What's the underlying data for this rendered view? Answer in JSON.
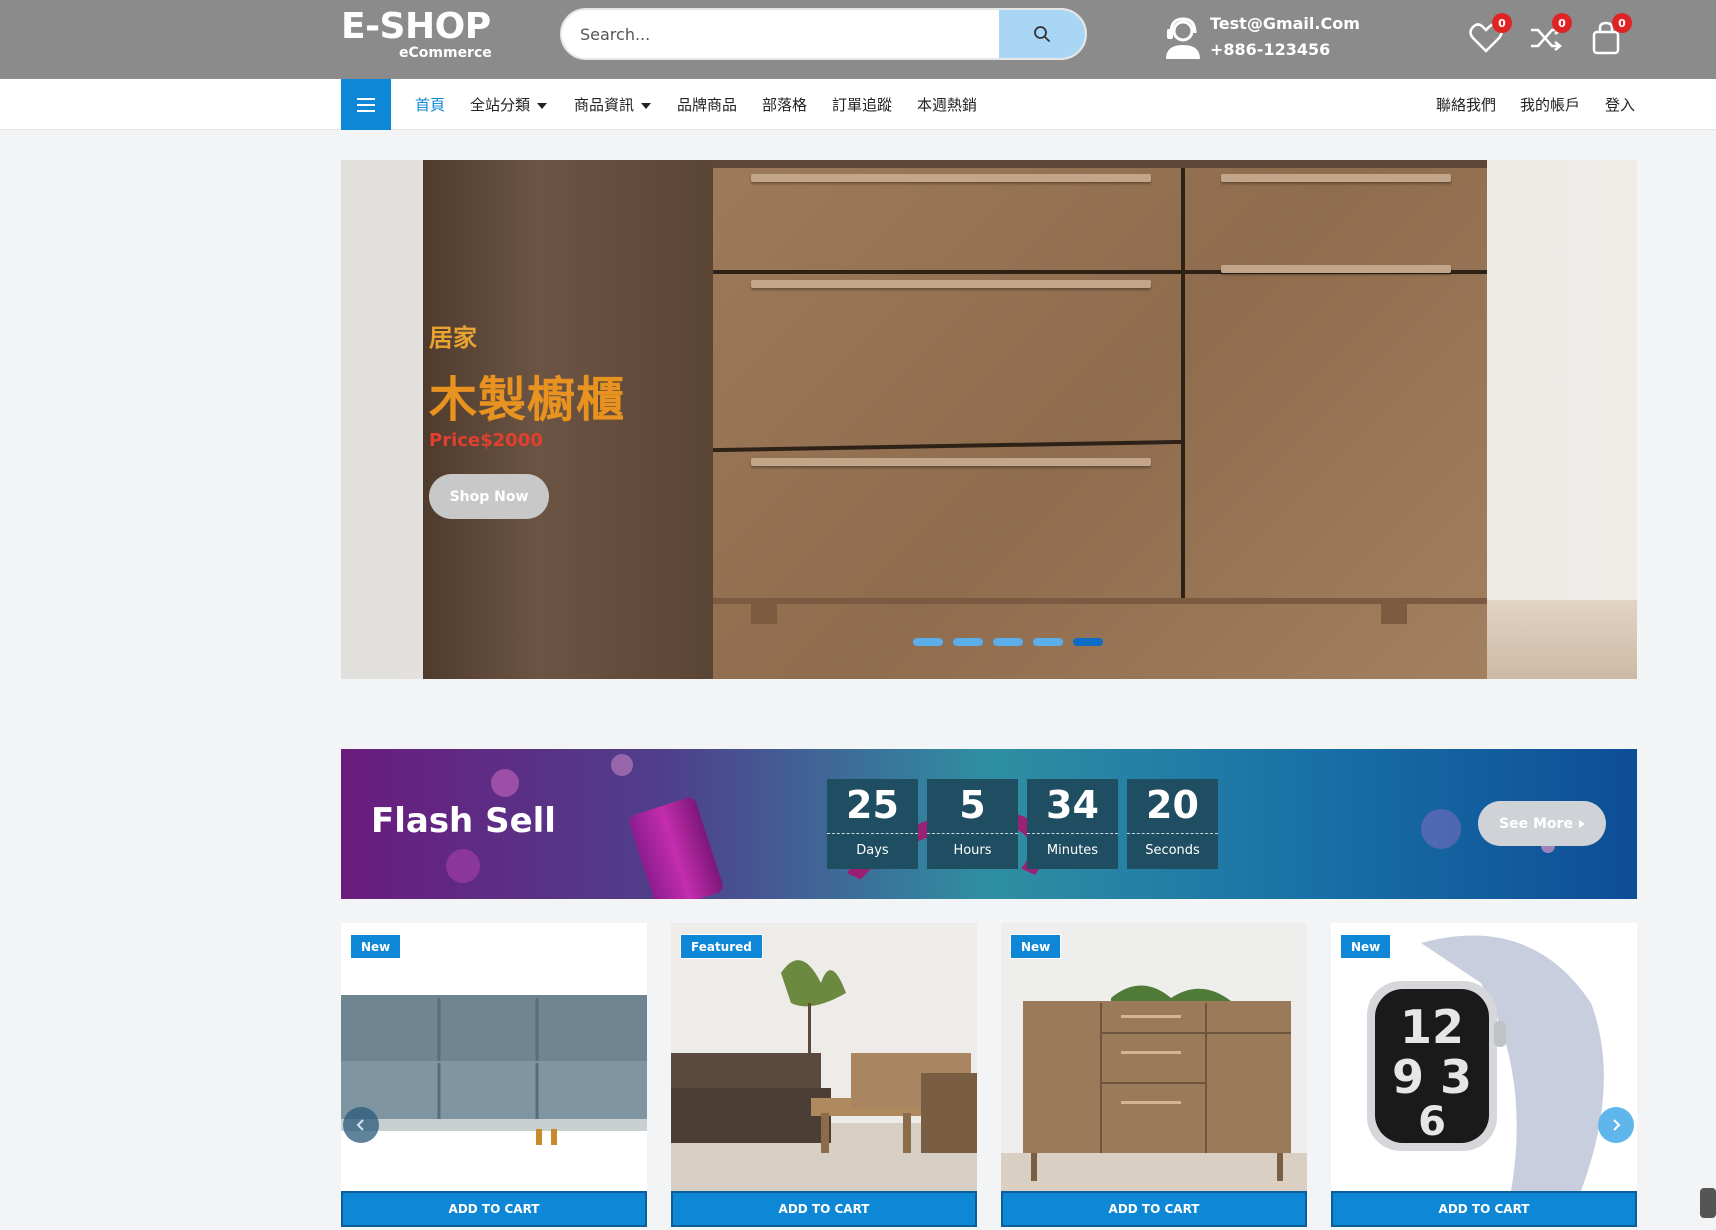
{
  "header": {
    "logo_main": "E-SHOP",
    "logo_sub": "eCommerce",
    "search_placeholder": "Search...",
    "contact_email": "Test@Gmail.Com",
    "contact_phone": "+886-123456",
    "wishlist_count": "0",
    "compare_count": "0",
    "cart_count": "0"
  },
  "nav": {
    "items": [
      "首頁",
      "全站分類",
      "商品資訊",
      "品牌商品",
      "部落格",
      "訂單追蹤",
      "本週熱銷"
    ],
    "right_items": [
      "聯絡我們",
      "我的帳戶",
      "登入"
    ]
  },
  "hero": {
    "subtitle": "居家",
    "title": "木製櫥櫃",
    "price": "Price$2000",
    "button": "Shop Now",
    "slide_count": 5,
    "active_slide": 5
  },
  "flash_sell": {
    "title": "Flash Sell",
    "countdown": [
      {
        "value": "25",
        "label": "Days"
      },
      {
        "value": "5",
        "label": "Hours"
      },
      {
        "value": "34",
        "label": "Minutes"
      },
      {
        "value": "20",
        "label": "Seconds"
      }
    ],
    "see_more": "See More"
  },
  "products": [
    {
      "badge": "New",
      "button": "ADD TO CART"
    },
    {
      "badge": "Featured",
      "button": "ADD TO CART"
    },
    {
      "badge": "New",
      "button": "ADD TO CART"
    },
    {
      "badge": "New",
      "button": "ADD TO CART"
    }
  ],
  "colors": {
    "header_bg": "#8b8b8b",
    "accent": "#0d87d6",
    "badge_red": "#e02424",
    "hero_title": "#e8921f",
    "hero_price": "#e0402e"
  }
}
